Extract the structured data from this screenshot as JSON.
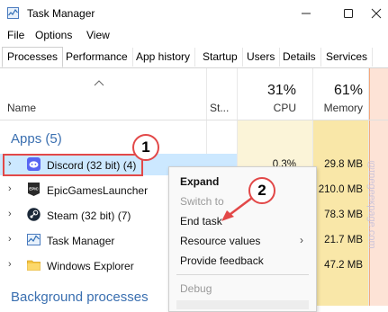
{
  "window": {
    "title": "Task Manager"
  },
  "menu": [
    "File",
    "Options",
    "View"
  ],
  "tabs": [
    "Processes",
    "Performance",
    "App history",
    "Startup",
    "Users",
    "Details",
    "Services"
  ],
  "header": {
    "name_label": "Name",
    "status_label": "St...",
    "cpu_percent": "31%",
    "cpu_label": "CPU",
    "memory_percent": "61%",
    "memory_label": "Memory"
  },
  "apps_group": {
    "title": "Apps (5)"
  },
  "rows": [
    {
      "name": "Discord (32 bit) (4)",
      "cpu": "0.3%",
      "memory": "29.8 MB",
      "icon": "discord-icon"
    },
    {
      "name": "EpicGamesLauncher",
      "cpu": "",
      "memory": "210.0 MB",
      "icon": "epic-games-icon"
    },
    {
      "name": "Steam (32 bit) (7)",
      "cpu": "",
      "memory": "78.3 MB",
      "icon": "steam-icon"
    },
    {
      "name": "Task Manager",
      "cpu": "",
      "memory": "21.7 MB",
      "icon": "task-manager-icon"
    },
    {
      "name": "Windows Explorer",
      "cpu": "",
      "memory": "47.2 MB",
      "icon": "folder-icon"
    }
  ],
  "background_group": {
    "title": "Background processes"
  },
  "context_menu": {
    "expand": "Expand",
    "switch_to": "Switch to",
    "end_task": "End task",
    "resource_values": "Resource values",
    "provide_feedback": "Provide feedback",
    "debug": "Debug"
  },
  "annotations": {
    "step1": "1",
    "step2": "2"
  },
  "watermark": "@thegeekpage.com",
  "colors": {
    "cpu_heat": "#fbf4d8",
    "memory_heat": "#f9e7a8",
    "memory_heat_strong": "#f5d77a",
    "selected_row": "#cce8ff",
    "annotation_red": "#e24848",
    "group_blue": "#3a6fb0",
    "sort_column_accent": "#f5a87c"
  }
}
